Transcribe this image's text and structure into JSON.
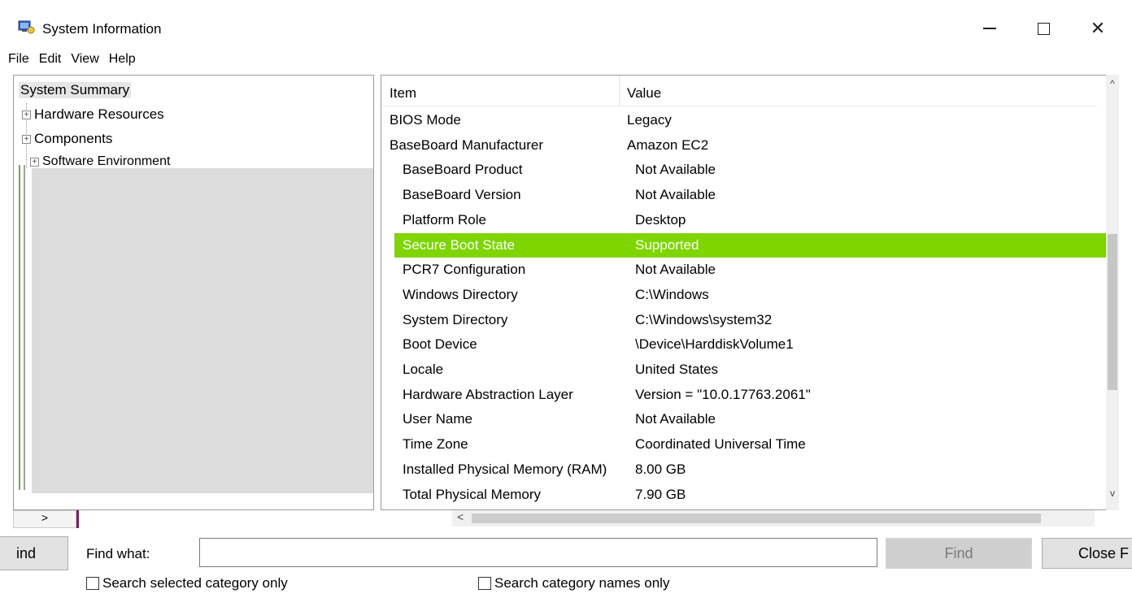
{
  "window": {
    "title": "System Information",
    "icon": "system-info-icon",
    "controls": {
      "minimize": "minimize-icon",
      "maximize": "maximize-icon",
      "close": "✕"
    }
  },
  "menu": [
    "File",
    "Edit",
    "View",
    "Help"
  ],
  "tree": {
    "root": "System Summary",
    "children": [
      "Hardware Resources",
      "Components",
      "Software Environment"
    ]
  },
  "list": {
    "headers": {
      "item": "Item",
      "value": "Value"
    },
    "rows": [
      {
        "item": "BIOS Mode",
        "value": "Legacy"
      },
      {
        "item": "BaseBoard Manufacturer",
        "value": "Amazon EC2"
      },
      {
        "item": "BaseBoard Product",
        "value": "Not Available"
      },
      {
        "item": "BaseBoard Version",
        "value": "Not Available"
      },
      {
        "item": "Platform Role",
        "value": "Desktop"
      },
      {
        "item": "Secure Boot State",
        "value": "Supported",
        "selected": true
      },
      {
        "item": "PCR7 Configuration",
        "value": "Not Available"
      },
      {
        "item": "Windows Directory",
        "value": "C:\\Windows"
      },
      {
        "item": "System Directory",
        "value": "C:\\Windows\\system32"
      },
      {
        "item": "Boot Device",
        "value": "\\Device\\HarddiskVolume1"
      },
      {
        "item": "Locale",
        "value": "United States"
      },
      {
        "item": "Hardware Abstraction Layer",
        "value": "Version = \"10.0.17763.2061\""
      },
      {
        "item": "User Name",
        "value": "Not Available"
      },
      {
        "item": "Time Zone",
        "value": "Coordinated Universal Time"
      },
      {
        "item": "Installed Physical Memory (RAM)",
        "value": "8.00 GB"
      },
      {
        "item": "Total Physical Memory",
        "value": "7.90 GB"
      }
    ],
    "selected_color": "#7ed500"
  },
  "find": {
    "left_button": "ind",
    "label": "Find what:",
    "input_value": "",
    "find_button": "Find",
    "close_button": "Close F",
    "option1": "Search selected category only",
    "option2": "Search category names only"
  }
}
